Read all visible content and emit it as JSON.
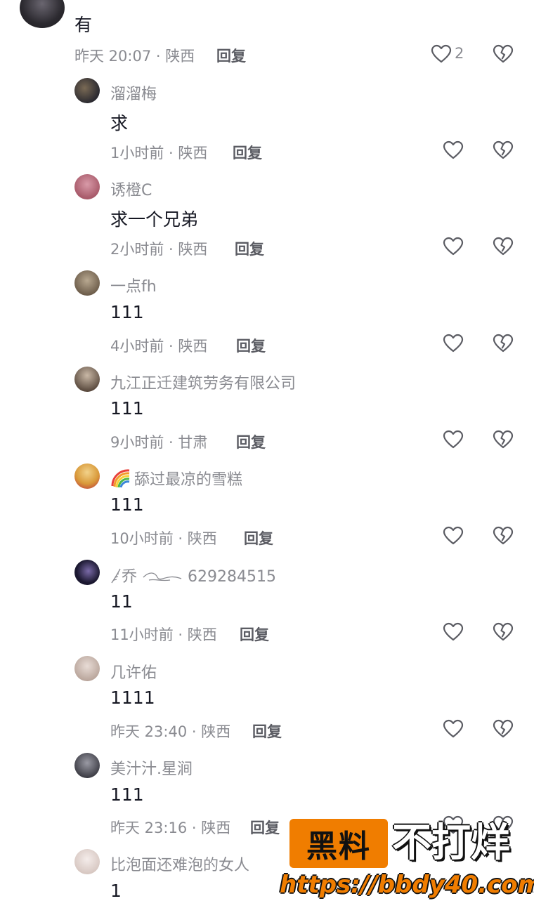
{
  "top_comment": {
    "content": "有",
    "meta": "昨天 20:07 · 陕西",
    "reply_label": "回复",
    "like_count": "2"
  },
  "replies": [
    {
      "name": "溜溜梅",
      "content": "求",
      "meta": "1小时前 · 陕西",
      "reply_label": "回复",
      "avatar_color": "#2b2a30"
    },
    {
      "name": "诱橙C",
      "content": "求一个兄弟",
      "meta": "2小时前 · 陕西",
      "reply_label": "回复",
      "avatar_color": "#b86a7a"
    },
    {
      "name": "一点fh",
      "content": "111",
      "meta": "4小时前 · 陕西",
      "reply_label": "回复",
      "avatar_color": "#8c7a66"
    },
    {
      "name": "九江正迁建筑劳务有限公司",
      "content": "111",
      "meta": "9小时前 · 甘肃",
      "reply_label": "回复",
      "avatar_color": "#6e5a4a"
    },
    {
      "name": "舔过最凉的雪糕",
      "content": "111",
      "meta": "10小时前 · 陕西",
      "reply_label": "回复",
      "avatar_color": "#d9a04a",
      "name_icon": "rainbow-icon"
    },
    {
      "name": "乔",
      "name_suffix": "629284515",
      "content": "11",
      "meta": "11小时前 · 陕西",
      "reply_label": "回复",
      "avatar_color": "#1b1830"
    },
    {
      "name": "几许佑",
      "content": "1111",
      "meta": "昨天 23:40 · 陕西",
      "reply_label": "回复",
      "avatar_color": "#c8b8b0"
    },
    {
      "name": "美汁汁.星涧",
      "content": "111",
      "meta": "昨天 23:16 · 陕西",
      "reply_label": "回复",
      "avatar_color": "#4a4a52"
    },
    {
      "name": "比泡面还难泡的女人",
      "content": "1",
      "meta": "",
      "reply_label": "",
      "avatar_color": "#e3d8d4"
    }
  ],
  "watermark": {
    "box_text": "黑料",
    "text": "不打烊",
    "url": "https://bbdy40.com"
  },
  "colors": {
    "accent_orange": "#f07d00",
    "text_gray": "#8a8b91"
  }
}
